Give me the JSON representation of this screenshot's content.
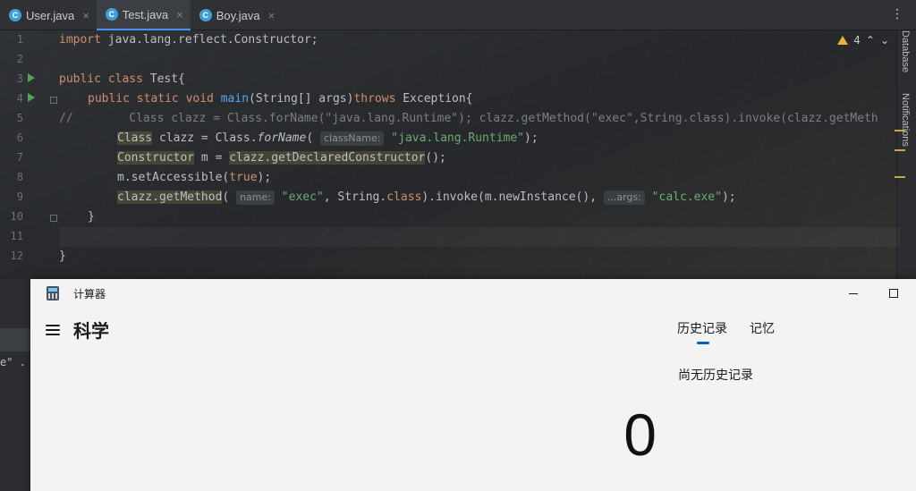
{
  "ide": {
    "tabs": [
      {
        "label": "User.java",
        "icon": "C"
      },
      {
        "label": "Test.java",
        "icon": "C"
      },
      {
        "label": "Boy.java",
        "icon": "C"
      }
    ],
    "line_numbers": [
      "1",
      "2",
      "3",
      "4",
      "5",
      "6",
      "7",
      "8",
      "9",
      "10",
      "11",
      "12"
    ],
    "warning_count": "4",
    "side_labels": {
      "database": "Database",
      "notifications": "Notifications"
    },
    "code": {
      "l1_kw": "import",
      "l1_rest": " java.lang.reflect.Constructor;",
      "l3_kw": "public class",
      "l3_rest": " Test{",
      "l4_kw1": "public static void",
      "l4_fn": "main",
      "l4_mid": "(String[] args)",
      "l4_kw2": "throws",
      "l4_rest": " Exception{",
      "l5": "//        Class clazz = Class.forName(\"java.lang.Runtime\"); clazz.getMethod(\"exec\",String.class).invoke(clazz.getMeth",
      "l6_a": "Class",
      "l6_b": " clazz = Class.",
      "l6_c": "forName",
      "l6_d": "(",
      "l6_hint": "className:",
      "l6_str": "\"java.lang.Runtime\"",
      "l6_e": ");",
      "l7_a": "Constructor",
      "l7_b": " m = ",
      "l7_c": "clazz.getDeclaredConstructor",
      "l7_d": "();",
      "l8_a": "m.setAccessible(",
      "l8_kw": "true",
      "l8_b": ");",
      "l9_a": "clazz.getMethod",
      "l9_b": "(",
      "l9_hint1": "name:",
      "l9_str1": "\"exec\"",
      "l9_c": ", String.",
      "l9_kw": "class",
      "l9_d": ").invoke(m.newInstance(), ",
      "l9_hint2": "...args:",
      "l9_str2": "\"calc.exe\"",
      "l9_e": ");",
      "l10": "}",
      "l12": "}"
    },
    "bottom_snippet": "e\" ."
  },
  "calculator": {
    "window_title": "计算器",
    "mode": "科学",
    "tabs": {
      "history": "历史记录",
      "memory": "记忆"
    },
    "empty_history": "尚无历史记录",
    "display_value": "0"
  }
}
